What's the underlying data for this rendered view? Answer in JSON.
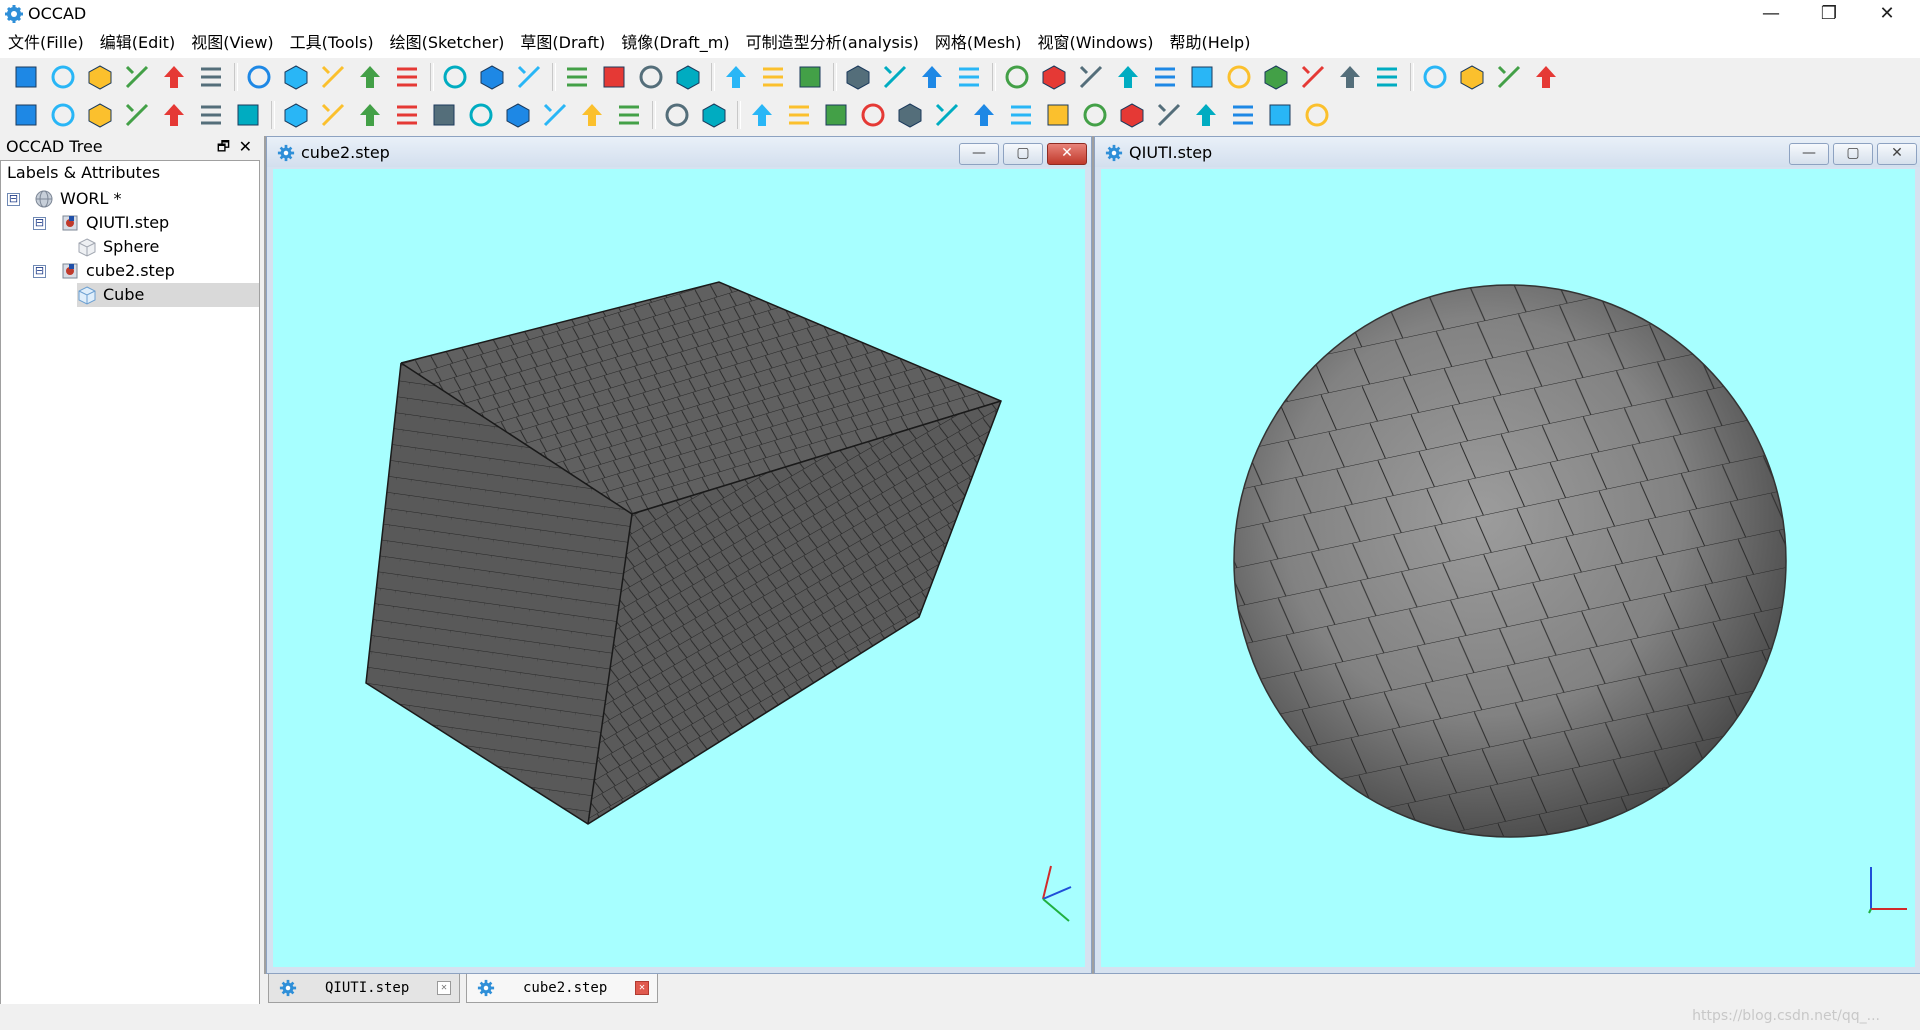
{
  "app": {
    "title": "OCCAD"
  },
  "window_controls": {
    "minimize": "—",
    "maximize": "❐",
    "close": "✕"
  },
  "menu": [
    "文件(Fille)",
    "编辑(Edit)",
    "视图(View)",
    "工具(Tools)",
    "绘图(Sketcher)",
    "草图(Draft)",
    "镜像(Draft_m)",
    "可制造型分析(analysis)",
    "网格(Mesh)",
    "视窗(Windows)",
    "帮助(Help)"
  ],
  "toolbar1": [
    "new-file",
    "open-file",
    "save",
    "cut",
    "copy",
    "paste",
    "|",
    "zoom-fit",
    "zoom-window",
    "no-display",
    "shaded",
    "wireframe",
    "|",
    "hidden-line",
    "points",
    "solid-view",
    "|",
    "view-front",
    "view-back",
    "view-top",
    "view-bottom",
    "|",
    "view-left",
    "view-right",
    "view-iso",
    "|",
    "measure",
    "select",
    "color-palette",
    "background-image",
    "|",
    "line",
    "polyline",
    "circle",
    "arc",
    "spline",
    "polygon",
    "rectangle",
    "text",
    "dimension",
    "bezier",
    "point",
    "|",
    "curve-s",
    "extrude-box",
    "profile",
    "eraser"
  ],
  "toolbar2": [
    "move",
    "rotate",
    "rotate-ccw",
    "mirror-h",
    "arrow-up",
    "arrow-down",
    "scale",
    "|",
    "sweep",
    "trim",
    "align-top",
    "align-bottom",
    "stack",
    "loft",
    "grid-array",
    "stairs",
    "revolve",
    "export",
    "|",
    "mirror",
    "half-mirror",
    "|",
    "grid",
    "lock",
    "snap-endpoint",
    "snap-mid",
    "snap-parallel",
    "snap-grid",
    "snap-angle",
    "snap-on-line",
    "snap-perpendicular",
    "snap-special",
    "snap-center",
    "snap-cross",
    "snap-intersect",
    "snap-extension",
    "snap-dimension",
    "snap-face"
  ],
  "tree": {
    "panel_title": "OCCAD Tree",
    "float_icon": "🗗",
    "close_icon": "✕",
    "column": "Labels & Attributes",
    "nodes": [
      {
        "label": "WORL *",
        "exp": "⊟"
      },
      {
        "label": "QIUTI.step",
        "exp": "⊟"
      },
      {
        "label": "Sphere",
        "exp": ""
      },
      {
        "label": "cube2.step",
        "exp": "⊟"
      },
      {
        "label": "Cube",
        "exp": ""
      }
    ]
  },
  "windows": {
    "left": {
      "title": "cube2.step",
      "min": "—",
      "max": "▢",
      "close": "✕"
    },
    "right": {
      "title": "QIUTI.step",
      "min": "—",
      "max": "▢",
      "close": "✕"
    }
  },
  "tabs": [
    {
      "label": "QIUTI.step",
      "close": "✕"
    },
    {
      "label": "cube2.step",
      "close": "✕"
    }
  ],
  "colors": {
    "viewport_bg": "#a7ffff",
    "mesh_fill": "#5d5d5d",
    "sphere_fill": "#8a8a8a",
    "mesh_line": "#202020"
  },
  "watermark": "https://blog.csdn.net/qq_..."
}
